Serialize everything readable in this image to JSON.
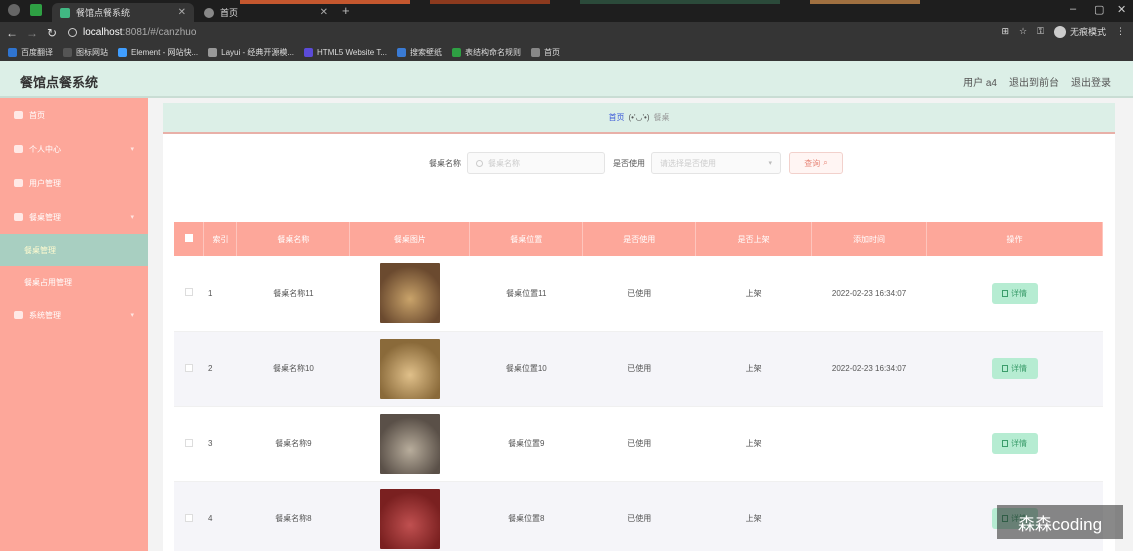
{
  "browser": {
    "active_tab": "餐馆点餐系统",
    "second_tab": "首页",
    "url_host": "localhost",
    "url_rest": ":8081/#/canzhuo",
    "profile_label": "无痕模式",
    "bookmarks": [
      {
        "label": "百度翻译",
        "color": "#2f74d0"
      },
      {
        "label": "图标网站",
        "color": "#555555"
      },
      {
        "label": "Element - 网站快...",
        "color": "#409eff"
      },
      {
        "label": "Layui - 经典开源模...",
        "color": "#999999"
      },
      {
        "label": "HTML5 Website T...",
        "color": "#5b4bd9"
      },
      {
        "label": "搜索壁纸",
        "color": "#3a7bd5"
      },
      {
        "label": "表结构命名规则",
        "color": "#2ea043"
      },
      {
        "label": "首页",
        "color": "#888888"
      }
    ]
  },
  "header": {
    "title": "餐馆点餐系统",
    "user": "用户 a4",
    "back_to_front": "退出到前台",
    "logout": "退出登录"
  },
  "sidebar": {
    "items": [
      {
        "label": "首页",
        "sub": false,
        "active": false,
        "chevron": false
      },
      {
        "label": "个人中心",
        "sub": false,
        "active": false,
        "chevron": true
      },
      {
        "label": "用户管理",
        "sub": false,
        "active": false,
        "chevron": false
      },
      {
        "label": "餐桌管理",
        "sub": false,
        "active": false,
        "chevron": true
      },
      {
        "label": "餐桌管理",
        "sub": true,
        "active": true,
        "chevron": false
      },
      {
        "label": "餐桌占用管理",
        "sub": true,
        "active": false,
        "chevron": false
      },
      {
        "label": "系统管理",
        "sub": false,
        "active": false,
        "chevron": true
      }
    ]
  },
  "breadcrumb": {
    "home": "首页",
    "emoticon": "(•'◡'•)",
    "current": "餐桌"
  },
  "search": {
    "name_label": "餐桌名称",
    "name_placeholder": "餐桌名称",
    "use_label": "是否使用",
    "use_placeholder": "请选择是否使用",
    "query_button": "查询"
  },
  "table": {
    "headers": [
      "索引",
      "餐桌名称",
      "餐桌图片",
      "餐桌位置",
      "是否使用",
      "是否上架",
      "添加时间",
      "操作"
    ],
    "detail_label": "详情",
    "rows": [
      {
        "index": "1",
        "name": "餐桌名称11",
        "location": "餐桌位置11",
        "used": "已使用",
        "listed": "上架",
        "time": "2022-02-23 16:34:07",
        "photo": [
          "#6b4a2f",
          "#c9a36a"
        ]
      },
      {
        "index": "2",
        "name": "餐桌名称10",
        "location": "餐桌位置10",
        "used": "已使用",
        "listed": "上架",
        "time": "2022-02-23 16:34:07",
        "photo": [
          "#8a6a3a",
          "#e0c08a"
        ]
      },
      {
        "index": "3",
        "name": "餐桌名称9",
        "location": "餐桌位置9",
        "used": "已使用",
        "listed": "上架",
        "time": "",
        "photo": [
          "#5a5048",
          "#b8ad9c"
        ]
      },
      {
        "index": "4",
        "name": "餐桌名称8",
        "location": "餐桌位置8",
        "used": "已使用",
        "listed": "上架",
        "time": "",
        "photo": [
          "#7a2020",
          "#c05050"
        ]
      }
    ]
  },
  "watermark": "森森coding"
}
